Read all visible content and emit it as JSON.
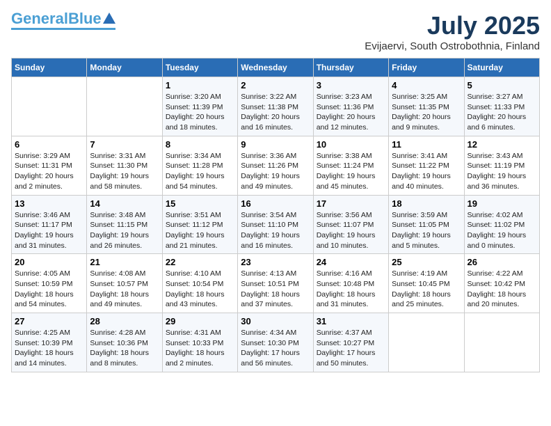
{
  "header": {
    "logo_line1": "General",
    "logo_line2": "Blue",
    "month": "July 2025",
    "location": "Evijaervi, South Ostrobothnia, Finland"
  },
  "weekdays": [
    "Sunday",
    "Monday",
    "Tuesday",
    "Wednesday",
    "Thursday",
    "Friday",
    "Saturday"
  ],
  "weeks": [
    [
      {
        "day": "",
        "info": ""
      },
      {
        "day": "",
        "info": ""
      },
      {
        "day": "1",
        "info": "Sunrise: 3:20 AM\nSunset: 11:39 PM\nDaylight: 20 hours\nand 18 minutes."
      },
      {
        "day": "2",
        "info": "Sunrise: 3:22 AM\nSunset: 11:38 PM\nDaylight: 20 hours\nand 16 minutes."
      },
      {
        "day": "3",
        "info": "Sunrise: 3:23 AM\nSunset: 11:36 PM\nDaylight: 20 hours\nand 12 minutes."
      },
      {
        "day": "4",
        "info": "Sunrise: 3:25 AM\nSunset: 11:35 PM\nDaylight: 20 hours\nand 9 minutes."
      },
      {
        "day": "5",
        "info": "Sunrise: 3:27 AM\nSunset: 11:33 PM\nDaylight: 20 hours\nand 6 minutes."
      }
    ],
    [
      {
        "day": "6",
        "info": "Sunrise: 3:29 AM\nSunset: 11:31 PM\nDaylight: 20 hours\nand 2 minutes."
      },
      {
        "day": "7",
        "info": "Sunrise: 3:31 AM\nSunset: 11:30 PM\nDaylight: 19 hours\nand 58 minutes."
      },
      {
        "day": "8",
        "info": "Sunrise: 3:34 AM\nSunset: 11:28 PM\nDaylight: 19 hours\nand 54 minutes."
      },
      {
        "day": "9",
        "info": "Sunrise: 3:36 AM\nSunset: 11:26 PM\nDaylight: 19 hours\nand 49 minutes."
      },
      {
        "day": "10",
        "info": "Sunrise: 3:38 AM\nSunset: 11:24 PM\nDaylight: 19 hours\nand 45 minutes."
      },
      {
        "day": "11",
        "info": "Sunrise: 3:41 AM\nSunset: 11:22 PM\nDaylight: 19 hours\nand 40 minutes."
      },
      {
        "day": "12",
        "info": "Sunrise: 3:43 AM\nSunset: 11:19 PM\nDaylight: 19 hours\nand 36 minutes."
      }
    ],
    [
      {
        "day": "13",
        "info": "Sunrise: 3:46 AM\nSunset: 11:17 PM\nDaylight: 19 hours\nand 31 minutes."
      },
      {
        "day": "14",
        "info": "Sunrise: 3:48 AM\nSunset: 11:15 PM\nDaylight: 19 hours\nand 26 minutes."
      },
      {
        "day": "15",
        "info": "Sunrise: 3:51 AM\nSunset: 11:12 PM\nDaylight: 19 hours\nand 21 minutes."
      },
      {
        "day": "16",
        "info": "Sunrise: 3:54 AM\nSunset: 11:10 PM\nDaylight: 19 hours\nand 16 minutes."
      },
      {
        "day": "17",
        "info": "Sunrise: 3:56 AM\nSunset: 11:07 PM\nDaylight: 19 hours\nand 10 minutes."
      },
      {
        "day": "18",
        "info": "Sunrise: 3:59 AM\nSunset: 11:05 PM\nDaylight: 19 hours\nand 5 minutes."
      },
      {
        "day": "19",
        "info": "Sunrise: 4:02 AM\nSunset: 11:02 PM\nDaylight: 19 hours\nand 0 minutes."
      }
    ],
    [
      {
        "day": "20",
        "info": "Sunrise: 4:05 AM\nSunset: 10:59 PM\nDaylight: 18 hours\nand 54 minutes."
      },
      {
        "day": "21",
        "info": "Sunrise: 4:08 AM\nSunset: 10:57 PM\nDaylight: 18 hours\nand 49 minutes."
      },
      {
        "day": "22",
        "info": "Sunrise: 4:10 AM\nSunset: 10:54 PM\nDaylight: 18 hours\nand 43 minutes."
      },
      {
        "day": "23",
        "info": "Sunrise: 4:13 AM\nSunset: 10:51 PM\nDaylight: 18 hours\nand 37 minutes."
      },
      {
        "day": "24",
        "info": "Sunrise: 4:16 AM\nSunset: 10:48 PM\nDaylight: 18 hours\nand 31 minutes."
      },
      {
        "day": "25",
        "info": "Sunrise: 4:19 AM\nSunset: 10:45 PM\nDaylight: 18 hours\nand 25 minutes."
      },
      {
        "day": "26",
        "info": "Sunrise: 4:22 AM\nSunset: 10:42 PM\nDaylight: 18 hours\nand 20 minutes."
      }
    ],
    [
      {
        "day": "27",
        "info": "Sunrise: 4:25 AM\nSunset: 10:39 PM\nDaylight: 18 hours\nand 14 minutes."
      },
      {
        "day": "28",
        "info": "Sunrise: 4:28 AM\nSunset: 10:36 PM\nDaylight: 18 hours\nand 8 minutes."
      },
      {
        "day": "29",
        "info": "Sunrise: 4:31 AM\nSunset: 10:33 PM\nDaylight: 18 hours\nand 2 minutes."
      },
      {
        "day": "30",
        "info": "Sunrise: 4:34 AM\nSunset: 10:30 PM\nDaylight: 17 hours\nand 56 minutes."
      },
      {
        "day": "31",
        "info": "Sunrise: 4:37 AM\nSunset: 10:27 PM\nDaylight: 17 hours\nand 50 minutes."
      },
      {
        "day": "",
        "info": ""
      },
      {
        "day": "",
        "info": ""
      }
    ]
  ]
}
